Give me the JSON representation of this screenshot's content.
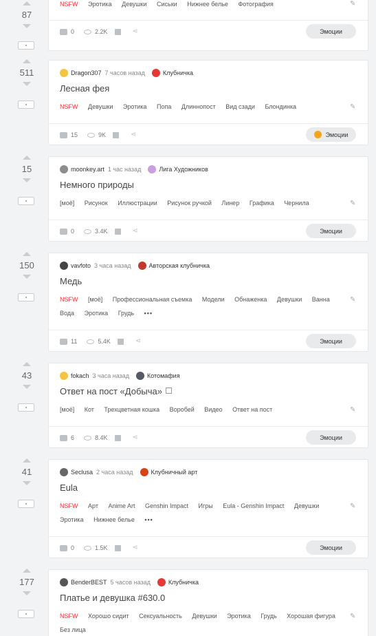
{
  "posts": [
    {
      "rating": "87",
      "author": "",
      "time": "",
      "community": "",
      "title": "",
      "tags": [
        "NSFW",
        "Эротика",
        "Девушки",
        "Сиськи",
        "Нижнее белье",
        "Фотография"
      ],
      "comments": "0",
      "views": "2.2K",
      "emotions_label": "Эмоции",
      "emotion_icon": false,
      "author_avatar_color": "",
      "community_icon_color": ""
    },
    {
      "rating": "511",
      "author": "Dragon307",
      "time": "7 часов назад",
      "community": "Клубничка",
      "title": "Лесная фея",
      "tags": [
        "NSFW",
        "Девушки",
        "Эротика",
        "Попа",
        "Длиннопост",
        "Вид сзади",
        "Блондинка"
      ],
      "comments": "15",
      "views": "9K",
      "emotions_label": "Эмоции",
      "emotion_icon": true,
      "author_avatar_color": "#f5c542",
      "community_icon_color": "#e53935"
    },
    {
      "rating": "15",
      "author": "moonkey.art",
      "time": "1 час назад",
      "community": "Лига Художников",
      "title": "Немного природы",
      "tags": [
        "[моё]",
        "Рисунок",
        "Иллюстрации",
        "Рисунок ручкой",
        "Линер",
        "Графика",
        "Чернила"
      ],
      "comments": "0",
      "views": "3.4K",
      "emotions_label": "Эмоции",
      "emotion_icon": false,
      "author_avatar_color": "#8d8d8d",
      "community_icon_color": "#c9a0dc"
    },
    {
      "rating": "150",
      "author": "vavfoto",
      "time": "3 часа назад",
      "community": "Авторская клубничка",
      "title": "Медь",
      "tags": [
        "NSFW",
        "[моё]",
        "Профессиональная съемка",
        "Модели",
        "Обнаженка",
        "Девушки",
        "Ванна",
        "Вода",
        "Эротика",
        "Грудь",
        "•••"
      ],
      "comments": "11",
      "views": "5.4K",
      "emotions_label": "Эмоции",
      "emotion_icon": false,
      "author_avatar_color": "#444444",
      "community_icon_color": "#c0392b"
    },
    {
      "rating": "43",
      "author": "fokach",
      "time": "3 часа назад",
      "community": "Котомафия",
      "title": "Ответ на пост «Добыча»",
      "tags": [
        "[моё]",
        "Кот",
        "Трехцветная кошка",
        "Воробей",
        "Видео",
        "Ответ на пост"
      ],
      "comments": "6",
      "views": "8.4K",
      "emotions_label": "Эмоции",
      "emotion_icon": false,
      "author_avatar_color": "#f5c542",
      "community_icon_color": "#555a66"
    },
    {
      "rating": "41",
      "author": "Seclusa",
      "time": "2 часа назад",
      "community": "Клубничный арт",
      "title": "Eula",
      "tags": [
        "NSFW",
        "Арт",
        "Anime Art",
        "Genshin Impact",
        "Игры",
        "Eula - Genshin Impact",
        "Девушки",
        "Эротика",
        "Нижнее белье",
        "•••"
      ],
      "comments": "0",
      "views": "1.5K",
      "emotions_label": "Эмоции",
      "emotion_icon": false,
      "author_avatar_color": "#666666",
      "community_icon_color": "#d84315"
    },
    {
      "rating": "177",
      "author": "BenderBEST",
      "time": "5 часов назад",
      "community": "Клубничка",
      "title": "Платье и девушка #630.0",
      "tags": [
        "NSFW",
        "Хорошо сидит",
        "Сексуальность",
        "Девушки",
        "Эротика",
        "Грудь",
        "Хорошая фигура",
        "Без лица"
      ],
      "comments": "",
      "views": "",
      "emotions_label": "",
      "emotion_icon": false,
      "author_avatar_color": "#555555",
      "community_icon_color": "#e53935"
    }
  ]
}
